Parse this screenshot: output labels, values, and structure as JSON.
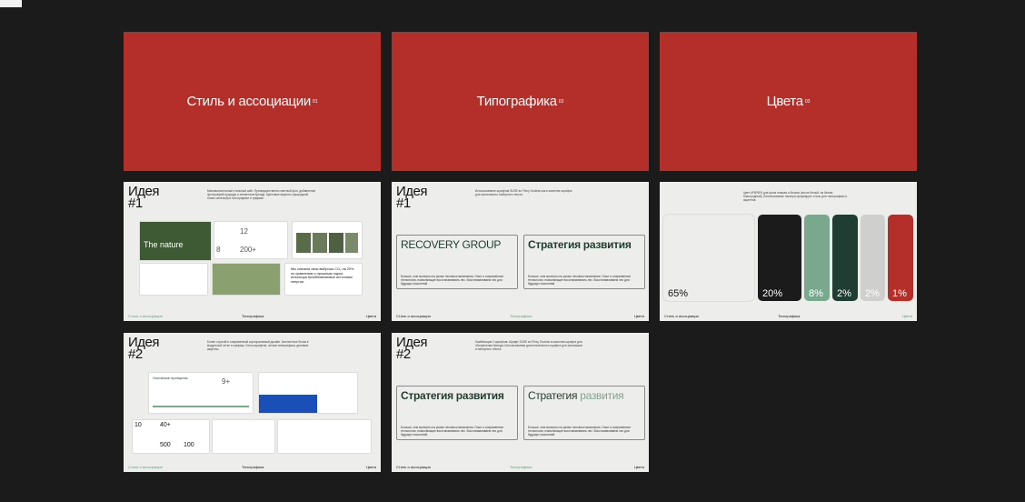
{
  "sections": [
    {
      "title": "Стиль и ассоциации",
      "num": "01"
    },
    {
      "title": "Типографика",
      "num": "02"
    },
    {
      "title": "Цвета",
      "num": "03"
    }
  ],
  "footer": {
    "style": "Стиль и ассоциации",
    "typo": "Типографика",
    "colors": "Цвета"
  },
  "idea1": {
    "label": "Идея #1",
    "desc": "Минималистичный стильный сайт. Преимущественно светлый фон, добавление фотографий природы и элементов бренда. Цветовые акценты (природный темно-зеленый) в типографике и графике.",
    "headline": "The nature",
    "stats": [
      "12",
      "200+",
      "8"
    ],
    "quote": "Мы снизили свои выбросы CO₂ на 20% по сравнению с прошлым годом, используя возобновляемые источники энергии."
  },
  "typo1": {
    "desc": "Использование шрифтов SUSE во Flexy Grotesk как в качестве шрифта для заголовков и наборного текста.",
    "box1": "RECOVERY GROUP",
    "box2": "Стратегия развития",
    "body": "Больше, чем эксперты на рынке лесовосстановления. Опыт и современные технологии, позволяющие восстанавливать лес. Восстанавливаем лес для будущих поколений."
  },
  "colors": {
    "desc": "Цвет #F6F6F6 для фона плашек и блоков (после белый, на белом благородный). Использование палитры формирует стиль для типографики и акцентов.",
    "swatches": [
      {
        "pct": "65%",
        "color": "#ededeb",
        "text": "#111"
      },
      {
        "pct": "20%",
        "color": "#1b1b1b",
        "text": "#fff"
      },
      {
        "pct": "8%",
        "color": "#7aa88f",
        "text": "#fff"
      },
      {
        "pct": "2%",
        "color": "#1f3d33",
        "text": "#fff"
      },
      {
        "pct": "2%",
        "color": "#cfcfcd",
        "text": "#fff"
      },
      {
        "pct": "1%",
        "color": "#b52f2a",
        "text": "#fff"
      }
    ]
  },
  "idea2": {
    "label": "Идея #2",
    "desc": "Более строгий и современный корпоративный дизайн. Контентные блоки в модульной сетке и графику. Сетка шрифтов, четкая типографика, деловые акценты.",
    "title": "Основные принципы",
    "stats": [
      "9+",
      "40+",
      "10",
      "500",
      "100"
    ]
  },
  "typo2": {
    "desc": "Комбинация 2 шрифтов: Шрифт SUSE во Flexy Grotesk в качестве шрифта для обозначения бренда; Использование дополнительного шрифта для заголовков и наборного текста.",
    "box1": "Стратегия развития",
    "box2a": "Стратегия ",
    "box2b": "развития",
    "body": "Больше, чем эксперты на рынке лесовосстановления. Опыт и современные технологии, позволяющие восстанавливать лес. Восстанавливаем лес для будущих поколений."
  }
}
